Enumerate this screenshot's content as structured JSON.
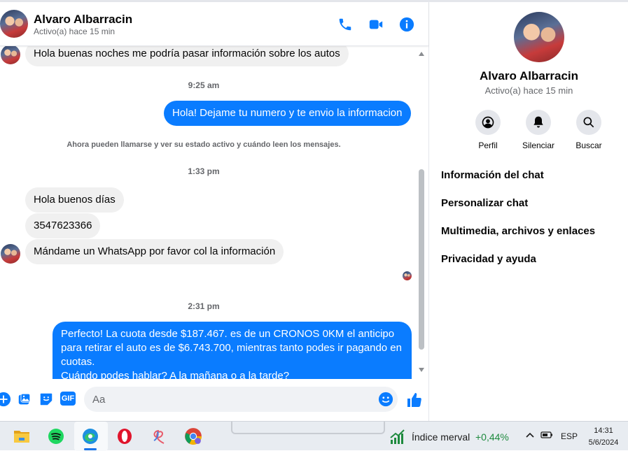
{
  "chat": {
    "contact_name": "Alvaro Albarracin",
    "contact_status": "Activo(a) hace 15 min",
    "header_actions": [
      "phone-icon",
      "video-icon",
      "info-icon"
    ]
  },
  "messages": {
    "m1": "Hola buenas noches me podría pasar información sobre los autos",
    "t1": "9:25 am",
    "m2": "Hola! Dejame tu numero y te envio la informacion",
    "sys": "Ahora pueden llamarse y ver su estado activo y cuándo leen los mensajes.",
    "t2": "1:33 pm",
    "m3": "Hola buenos días",
    "m4": "3547623366",
    "m5": "Mándame un WhatsApp por favor col la información",
    "t3": "2:31 pm",
    "m6": "Perfecto! La cuota desde $187.467. es de un CRONOS 0KM el anticipo para retirar el auto es de $6.743.700, mientras tanto podes ir pagando en cuotas.",
    "m6b": "Cuándo podes hablar? A la mañana o a la tarde?"
  },
  "composer": {
    "placeholder": "Aa",
    "value": "",
    "gif_label": "GIF"
  },
  "panel": {
    "name": "Alvaro Albarracin",
    "status": "Activo(a) hace 15 min",
    "actions": {
      "profile": "Perfil",
      "mute": "Silenciar",
      "search": "Buscar"
    },
    "items": {
      "chat_info": "Información del chat",
      "customize": "Personalizar chat",
      "media": "Multimedia, archivos y enlaces",
      "privacy": "Privacidad y ayuda"
    }
  },
  "taskbar": {
    "stock_name": "Índice merval",
    "stock_change": "+0,44%",
    "language": "ESP",
    "time": "14:31",
    "date": "5/6/2024"
  },
  "colors": {
    "accent": "#0a7cff",
    "incoming_bubble": "#f0f0f0",
    "secondary_text": "#65676b",
    "stock_up": "#1e8a3e"
  }
}
